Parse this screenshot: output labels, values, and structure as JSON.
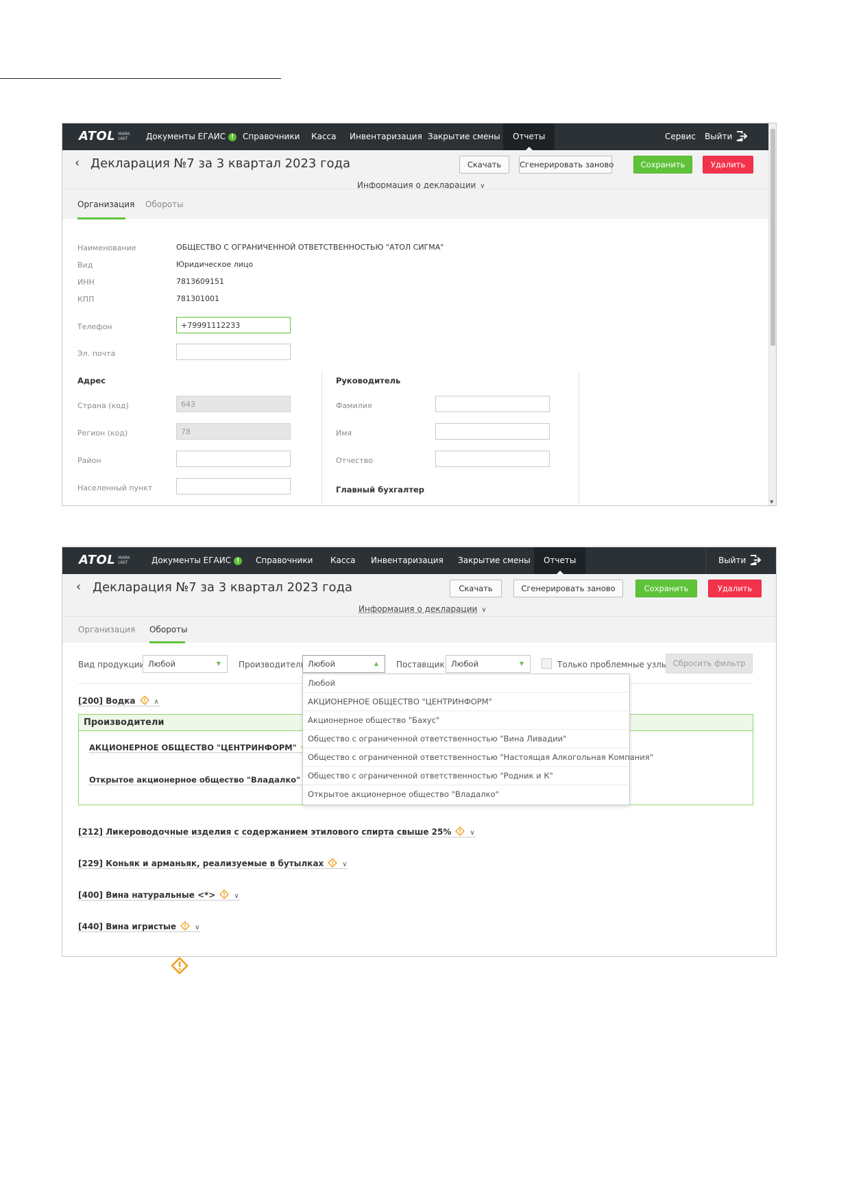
{
  "app": {
    "logo_text": "ATOL",
    "logo_sub_1": "MARK",
    "logo_sub_2": "UNIT",
    "nav": {
      "docs": "Документы ЕГАИС",
      "docs_badge": "!",
      "refs": "Справочники",
      "kassa": "Касса",
      "inventory": "Инвентаризация",
      "shift_close": "Закрытие смены",
      "reports": "Отчеты",
      "service": "Сервис",
      "logout": "Выйти"
    },
    "colors": {
      "accent_green": "#5fc33a",
      "danger_red": "#f3334b",
      "nav_bg": "#2b3135",
      "warning_orange": "#f0a020"
    }
  },
  "declaration": {
    "title": "Декларация №7 за 3 квартал 2023 года",
    "btn_download": "Скачать",
    "btn_regenerate": "Сгенерировать заново",
    "btn_save": "Сохранить",
    "btn_delete": "Удалить",
    "info_link": "Информация о декларации",
    "tab_org": "Организация",
    "tab_turnover": "Обороты"
  },
  "organization": {
    "name_label": "Наименование",
    "name_value": "ОБЩЕСТВО С ОГРАНИЧЕННОЙ ОТВЕТСТВЕННОСТЬЮ \"АТОЛ СИГМА\"",
    "type_label": "Вид",
    "type_value": "Юридическое лицо",
    "inn_label": "ИНН",
    "inn_value": "7813609151",
    "kpp_label": "КПП",
    "kpp_value": "781301001",
    "phone_label": "Телефон",
    "phone_value": "+79991112233",
    "email_label": "Эл. почта",
    "email_value": "",
    "address_heading": "Адрес",
    "country_label": "Страна (код)",
    "country_value": "643",
    "region_label": "Регион (код)",
    "region_value": "78",
    "district_label": "Район",
    "district_value": "",
    "locality_label": "Населенный пункт",
    "locality_value": "",
    "manager_heading": "Руководитель",
    "surname_label": "Фамилия",
    "name2_label": "Имя",
    "patronymic_label": "Отчество",
    "accountant_heading": "Главный бухгалтер"
  },
  "turnover": {
    "filter": {
      "product_type_label": "Вид продукции",
      "product_type_value": "Любой",
      "producer_label": "Производитель",
      "producer_value": "Любой",
      "supplier_label": "Поставщик",
      "supplier_value": "Любой",
      "problem_only_label": "Только проблемные узлы",
      "reset_label": "Сбросить фильтр"
    },
    "producer_options": [
      "Любой",
      "АКЦИОНЕРНОЕ ОБЩЕСТВО \"ЦЕНТРИНФОРМ\"",
      "Акционерное общество \"Бахус\"",
      "Общество с ограниченной ответственностью \"Вина Ливадии\"",
      "Общество с ограниченной ответственностью \"Настоящая Алкогольная Компания\"",
      "Общество с ограниченной ответственностью \"Родник и К\"",
      "Открытое акционерное общество \"Владалко\""
    ],
    "groups": [
      {
        "label": "[200] Водка",
        "expanded": true
      },
      {
        "label": "[212] Ликероводочные изделия с содержанием этилового спирта свыше 25%",
        "expanded": false
      },
      {
        "label": "[229] Коньяк и арманьяк, реализуемые в бутылках",
        "expanded": false
      },
      {
        "label": "[400] Вина натуральные <*>",
        "expanded": false
      },
      {
        "label": "[440] Вина игристые",
        "expanded": false
      }
    ],
    "producers_heading": "Производители",
    "producers": [
      "АКЦИОНЕРНОЕ ОБЩЕСТВО \"ЦЕНТРИНФОРМ\"",
      "Открытое акционерное общество \"Владалко\""
    ]
  }
}
